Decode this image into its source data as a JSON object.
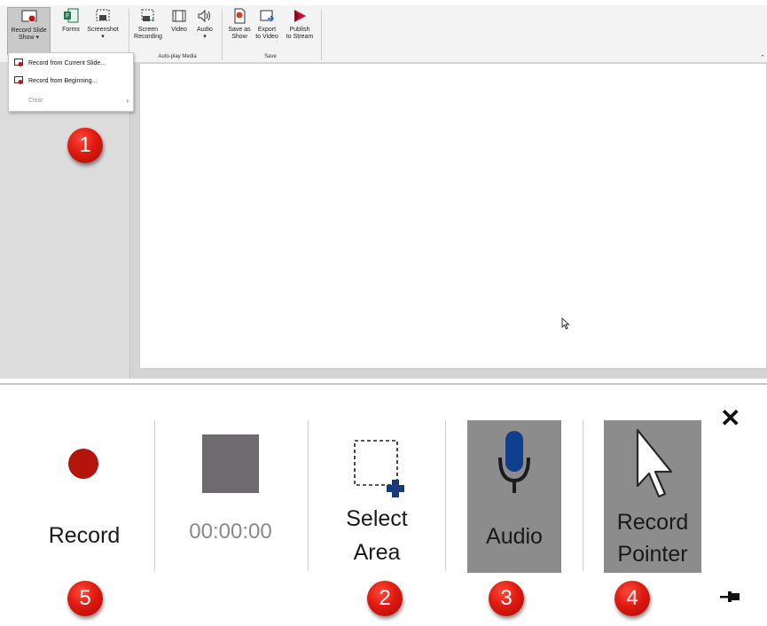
{
  "ribbon": {
    "buttons": {
      "record_slide_show": "Record Slide\nShow ▾",
      "forms": "Forms",
      "screenshot": "Screenshot\n▾",
      "screen_recording": "Screen\nRecording",
      "video": "Video",
      "audio": "Audio\n▾",
      "save_as_show": "Save as\nShow",
      "export_to_video": "Export\nto Video",
      "publish_to_stream": "Publish\nto Stream"
    },
    "groups": {
      "auto_play_media": "Auto-play Media",
      "save": "Save"
    }
  },
  "menu": {
    "items": [
      "Record from Current Slide...",
      "Record from Beginning...",
      "Clear"
    ]
  },
  "badges": {
    "b1": "1",
    "b2": "2",
    "b3": "3",
    "b4": "4",
    "b5": "5"
  },
  "toolbar": {
    "record": "Record",
    "timer": "00:00:00",
    "select_area_line1": "Select",
    "select_area_line2": "Area",
    "audio": "Audio",
    "record_pointer_line1": "Record",
    "record_pointer_line2": "Pointer",
    "close": "✕"
  },
  "colors": {
    "badge_red": "#e01a10",
    "record_red": "#b3140c",
    "stop_gray": "#6e6b6f",
    "toggle_on_gray": "#8c8c8c",
    "mic_blue": "#0f3f8e"
  },
  "icons": {
    "record_slide_show": "record-slide-show-icon",
    "forms": "forms-icon",
    "screenshot": "screenshot-icon",
    "screen_recording": "screen-recording-icon",
    "video": "video-icon",
    "audio": "speaker-icon",
    "save_as_show": "save-as-show-icon",
    "export_to_video": "export-video-icon",
    "publish_to_stream": "publish-stream-icon",
    "select_area": "select-area-icon",
    "mic": "microphone-icon",
    "pointer": "pointer-icon",
    "pin": "pin-icon"
  }
}
